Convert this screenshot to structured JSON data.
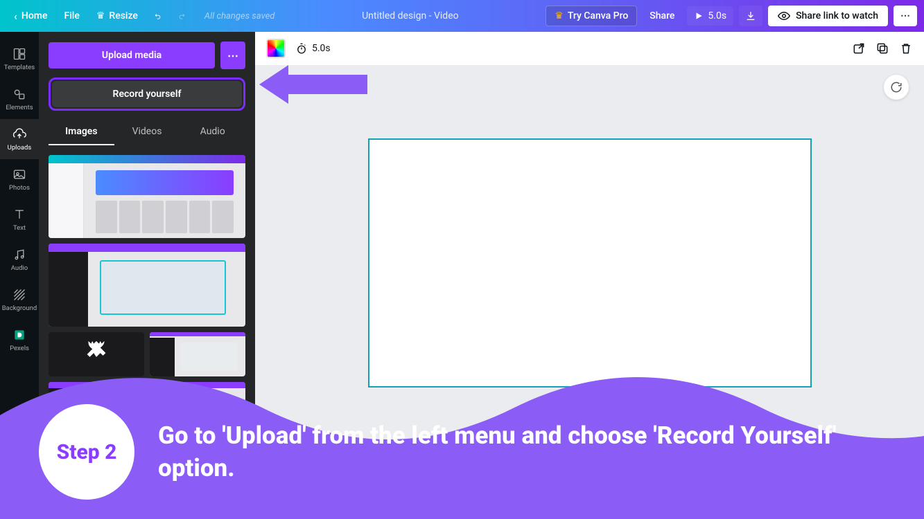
{
  "topbar": {
    "home": "Home",
    "file": "File",
    "resize": "Resize",
    "status": "All changes saved",
    "title": "Untitled design - Video",
    "pro": "Try Canva Pro",
    "share": "Share",
    "play_time": "5.0s",
    "sharelink": "Share link to watch"
  },
  "rail": {
    "items": [
      {
        "label": "Templates"
      },
      {
        "label": "Elements"
      },
      {
        "label": "Uploads"
      },
      {
        "label": "Photos"
      },
      {
        "label": "Text"
      },
      {
        "label": "Audio"
      },
      {
        "label": "Background"
      },
      {
        "label": "Pexels"
      }
    ]
  },
  "panel": {
    "upload": "Upload media",
    "record": "Record yourself",
    "tabs": [
      "Images",
      "Videos",
      "Audio"
    ]
  },
  "stage": {
    "duration": "5.0s"
  },
  "overlay": {
    "step": "Step 2",
    "text": "Go to 'Upload' from the left menu and choose 'Record Yourself' option."
  }
}
